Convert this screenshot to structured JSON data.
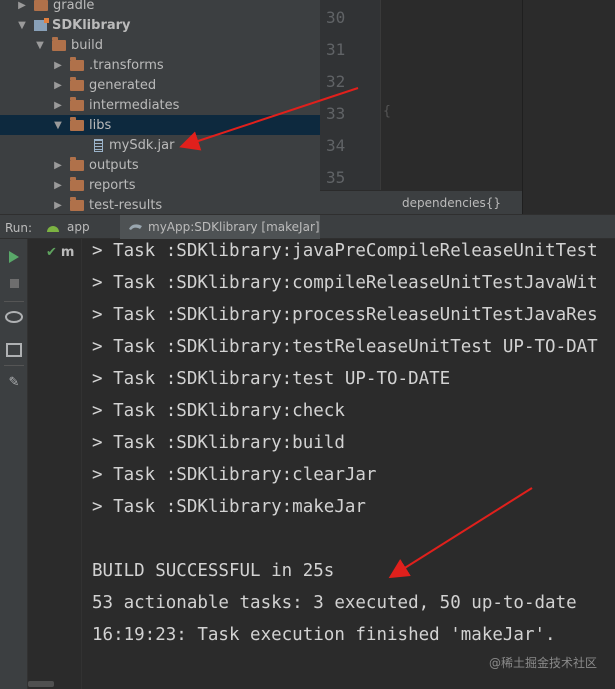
{
  "project_tree": {
    "items": [
      {
        "label": "gradle",
        "kind": "folder",
        "expanded": false
      },
      {
        "label": "SDKlibrary",
        "kind": "module",
        "expanded": true
      },
      {
        "label": "build",
        "kind": "folder",
        "expanded": true
      },
      {
        "label": ".transforms",
        "kind": "folder",
        "expanded": false
      },
      {
        "label": "generated",
        "kind": "folder",
        "expanded": false
      },
      {
        "label": "intermediates",
        "kind": "folder",
        "expanded": false
      },
      {
        "label": "libs",
        "kind": "folder",
        "expanded": true,
        "selected": true
      },
      {
        "label": "mySdk.jar",
        "kind": "jar"
      },
      {
        "label": "outputs",
        "kind": "folder",
        "expanded": false
      },
      {
        "label": "reports",
        "kind": "folder",
        "expanded": false
      },
      {
        "label": "test-results",
        "kind": "folder",
        "expanded": false
      }
    ]
  },
  "editor": {
    "line_numbers": [
      "30",
      "31",
      "32",
      "33",
      "34",
      "35"
    ],
    "fold_marker": "{",
    "breadcrumb": "dependencies{}"
  },
  "run_bar": {
    "label": "Run:",
    "tabs": [
      {
        "label": "app"
      },
      {
        "label": "myApp:SDKlibrary [makeJar]",
        "active": true
      }
    ]
  },
  "run_tree": {
    "item_label": "m"
  },
  "console": {
    "lines": [
      "> Task :SDKlibrary:javaPreCompileReleaseUnitTest",
      "> Task :SDKlibrary:compileReleaseUnitTestJavaWit",
      "> Task :SDKlibrary:processReleaseUnitTestJavaRes",
      "> Task :SDKlibrary:testReleaseUnitTest UP-TO-DAT",
      "> Task :SDKlibrary:test UP-TO-DATE",
      "> Task :SDKlibrary:check",
      "> Task :SDKlibrary:build",
      "> Task :SDKlibrary:clearJar",
      "> Task :SDKlibrary:makeJar",
      "",
      "BUILD SUCCESSFUL in 25s",
      "53 actionable tasks: 3 executed, 50 up-to-date",
      "16:19:23: Task execution finished 'makeJar'."
    ]
  },
  "watermark": "@稀土掘金技术社区",
  "colors": {
    "annotation_arrow": "#e0201c",
    "folder": "#b0714a",
    "success_check": "#5fa35f"
  }
}
